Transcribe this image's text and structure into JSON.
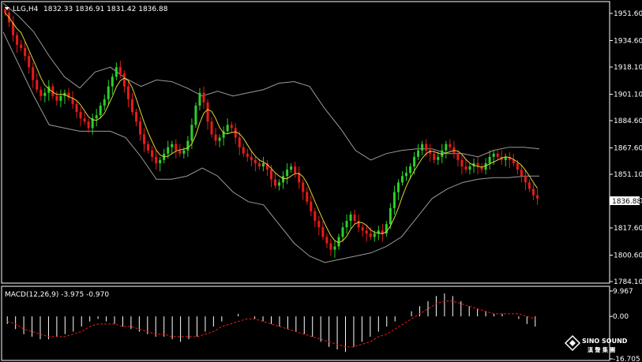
{
  "header": {
    "symbol_label": "LLG,H4",
    "ohlc": "1832.33 1836.91 1831.42 1836.88"
  },
  "indicator": {
    "label": "MACD(12,26,9) -3.975 -0.970"
  },
  "logo": {
    "text": "SINO SOUND",
    "subtitle": "漢 聲 集 團"
  },
  "colors": {
    "background": "#000000",
    "grid_border": "#ffffff",
    "bull": "#2bd02b",
    "bear": "#e81a1a",
    "band": "#9a9a9a",
    "ma": "#e0d238",
    "histogram": "#ffffff",
    "signal": "#e81a1a"
  },
  "chart_data": [
    {
      "type": "candlestick",
      "title": "LLG,H4",
      "yticks": [
        "1951.60",
        "1934.60",
        "1918.10",
        "1901.10",
        "1884.60",
        "1867.60",
        "1851.10",
        "1834.60",
        "1817.60",
        "1800.60",
        "1784.10"
      ],
      "ylim": [
        1784.1,
        1958
      ],
      "current_price": "1836.88",
      "series": [
        {
          "name": "price_close_approx",
          "values": [
            1952,
            1946,
            1938,
            1932,
            1930,
            1925,
            1918,
            1910,
            1904,
            1900,
            1902,
            1906,
            1900,
            1897,
            1900,
            1902,
            1899,
            1895,
            1890,
            1886,
            1884,
            1880,
            1886,
            1888,
            1894,
            1898,
            1906,
            1912,
            1918,
            1914,
            1906,
            1898,
            1890,
            1884,
            1876,
            1870,
            1866,
            1862,
            1858,
            1860,
            1864,
            1868,
            1870,
            1866,
            1864,
            1866,
            1872,
            1882,
            1894,
            1902,
            1896,
            1884,
            1876,
            1872,
            1874,
            1878,
            1882,
            1880,
            1874,
            1868,
            1864,
            1862,
            1860,
            1858,
            1856,
            1858,
            1854,
            1848,
            1844,
            1846,
            1850,
            1854,
            1856,
            1852,
            1846,
            1840,
            1834,
            1828,
            1822,
            1818,
            1812,
            1808,
            1804,
            1806,
            1812,
            1818,
            1822,
            1826,
            1822,
            1818,
            1816,
            1814,
            1812,
            1814,
            1816,
            1814,
            1820,
            1830,
            1840,
            1846,
            1850,
            1852,
            1856,
            1862,
            1866,
            1870,
            1866,
            1864,
            1860,
            1862,
            1866,
            1870,
            1868,
            1864,
            1860,
            1856,
            1854,
            1856,
            1858,
            1856,
            1854,
            1858,
            1862,
            1864,
            1862,
            1860,
            1862,
            1860,
            1858,
            1854,
            1850,
            1846,
            1842,
            1838,
            1836
          ]
        },
        {
          "name": "bollinger_upper",
          "values": [
            1958,
            1950,
            1940,
            1925,
            1912,
            1905,
            1915,
            1918,
            1911,
            1906,
            1910,
            1909,
            1905,
            1900,
            1903,
            1900,
            1902,
            1904,
            1908,
            1909,
            1906,
            1892,
            1880,
            1866,
            1860,
            1864,
            1866,
            1867,
            1867,
            1864,
            1864,
            1862,
            1866,
            1868,
            1868,
            1867
          ]
        },
        {
          "name": "bollinger_lower",
          "values": [
            1940,
            1920,
            1900,
            1882,
            1880,
            1878,
            1878,
            1878,
            1874,
            1862,
            1848,
            1848,
            1850,
            1855,
            1850,
            1840,
            1834,
            1832,
            1820,
            1808,
            1800,
            1796,
            1798,
            1800,
            1802,
            1806,
            1812,
            1824,
            1836,
            1842,
            1846,
            1848,
            1849,
            1849,
            1850,
            1850
          ]
        }
      ]
    },
    {
      "type": "bar",
      "title": "MACD(12,26,9) -3.975 -0.970",
      "yticks": [
        "9.967",
        "0.00",
        "-16.705"
      ],
      "ylim": [
        -16.705,
        9.967
      ],
      "series": [
        {
          "name": "MACD",
          "values": [
            -3,
            -5,
            -7,
            -8,
            -9,
            -9,
            -8,
            -7,
            -6,
            -4,
            -2,
            -1,
            -2,
            -3,
            -4,
            -5,
            -6,
            -7,
            -8,
            -8,
            -9,
            -10,
            -9,
            -8,
            -6,
            -4,
            -2,
            0,
            1,
            0,
            -1,
            -2,
            -3,
            -4,
            -5,
            -6,
            -7,
            -8,
            -10,
            -12,
            -13,
            -14,
            -12,
            -10,
            -8,
            -6,
            -4,
            -2,
            0,
            2,
            4,
            6,
            8,
            9,
            8,
            6,
            4,
            3,
            2,
            1,
            1,
            0,
            -1,
            -3,
            -4
          ]
        },
        {
          "name": "signal",
          "values": [
            -2,
            -3,
            -5,
            -6,
            -7,
            -8,
            -8,
            -8,
            -7,
            -6,
            -4,
            -3,
            -3,
            -3,
            -4,
            -4,
            -5,
            -6,
            -7,
            -7,
            -8,
            -8,
            -8,
            -8,
            -7,
            -6,
            -4,
            -3,
            -2,
            -1,
            -1,
            -2,
            -3,
            -4,
            -5,
            -6,
            -7,
            -8,
            -9,
            -10,
            -11,
            -12,
            -12,
            -11,
            -10,
            -8,
            -7,
            -5,
            -3,
            -1,
            1,
            3,
            5,
            6,
            6,
            5,
            4,
            3,
            2,
            1,
            1,
            1,
            1,
            0,
            -1
          ]
        }
      ]
    }
  ]
}
